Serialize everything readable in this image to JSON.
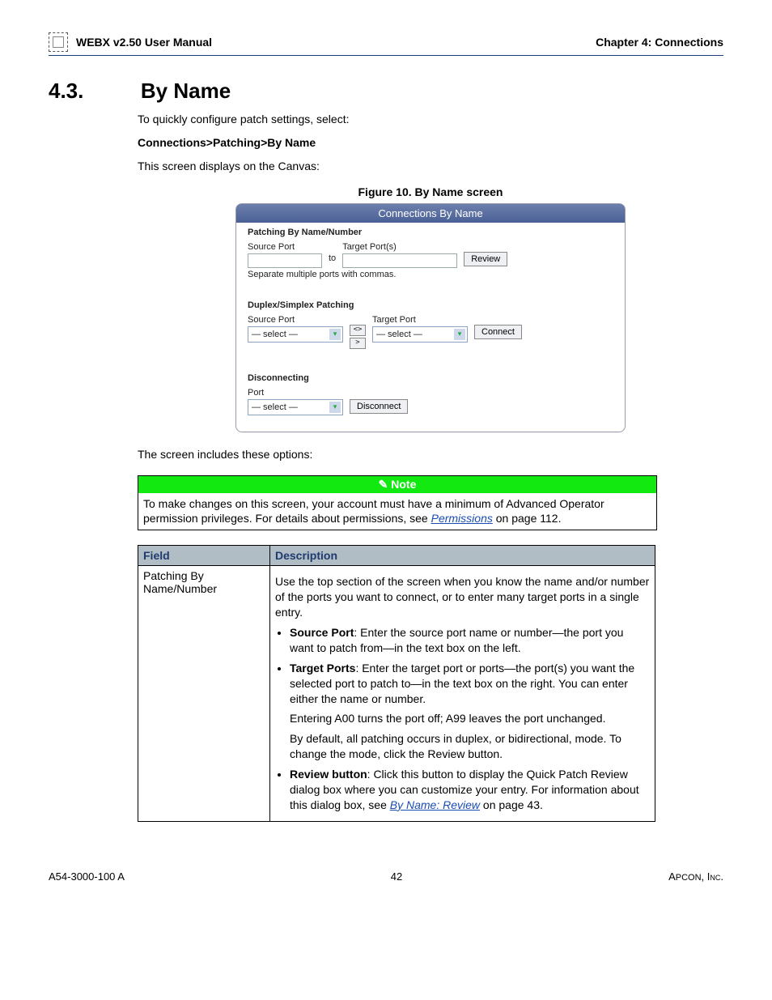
{
  "header": {
    "left_prefix": "W",
    "left_smallcaps": "EB",
    "left_rest": "X v2.50 User Manual",
    "right": "Chapter 4: Connections"
  },
  "section": {
    "number": "4.3.",
    "title": "By Name",
    "intro": "To quickly configure patch settings, select:",
    "breadcrumb": "Connections>Patching>By Name",
    "canvas_line": "This screen displays on the Canvas:",
    "figure_caption": "Figure 10. By Name screen",
    "options_line": "The screen includes these options:"
  },
  "screenshot": {
    "title": "Connections By Name",
    "patchnn": {
      "heading": "Patching By Name/Number",
      "source_label": "Source Port",
      "target_label": "Target Port(s)",
      "to": "to",
      "review": "Review",
      "hint": "Separate multiple ports with commas."
    },
    "duplex": {
      "heading": "Duplex/Simplex Patching",
      "source_label": "Source Port",
      "target_label": "Target Port",
      "select_placeholder": "— select —",
      "connect": "Connect",
      "bidir": "<>",
      "right": ">"
    },
    "disc": {
      "heading": "Disconnecting",
      "port_label": "Port",
      "select_placeholder": "— select —",
      "disconnect": "Disconnect"
    }
  },
  "note": {
    "header": "Note",
    "body_pre": "To make changes on this screen, your account must have a minimum of Advanced Operator permission privileges. For details about permissions, see ",
    "link": "Permissions",
    "body_post": " on page 112."
  },
  "table": {
    "col1": "Field",
    "col2": "Description",
    "row1_field": "Patching By Name/Number",
    "row1": {
      "p1": "Use the top section of the screen when you know the name and/or number of the ports you want to connect, or to enter many target ports in a single entry.",
      "b1_bold": "Source Port",
      "b1_rest": ": Enter the source port name or number—the port you want to patch from—in the text box on the left.",
      "b2_bold": "Target Ports",
      "b2_rest": ": Enter the target port or ports—the port(s) you want the selected port to patch to—in the text box on the right. You can enter either the name or number.",
      "b2_extra1": "Entering A00 turns the port off; A99 leaves the port unchanged.",
      "b2_extra2": "By default, all patching occurs in duplex, or bidirectional, mode. To change the mode, click the Review button.",
      "b3_bold": "Review button",
      "b3_rest_pre": ": Click this button to display the Quick Patch Review dialog box where you can customize your entry. For information about this dialog box, see ",
      "b3_link": "By Name: Review",
      "b3_rest_post": " on page 43."
    }
  },
  "footer": {
    "left": "A54-3000-100 A",
    "mid": "42",
    "right_pre": "A",
    "right_sc": "PCON",
    "right_post": ", Inc."
  }
}
